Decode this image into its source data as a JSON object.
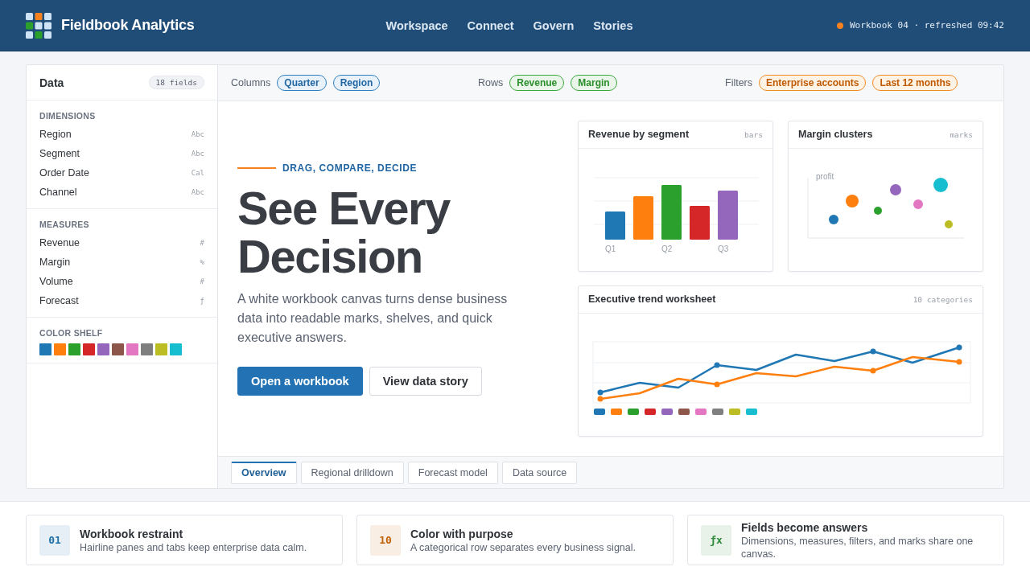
{
  "header": {
    "brand": "Fieldbook Analytics",
    "nav": [
      {
        "label": "Workspace"
      },
      {
        "label": "Connect"
      },
      {
        "label": "Govern"
      },
      {
        "label": "Stories"
      }
    ],
    "status": "Workbook 04 · refreshed 09:42"
  },
  "sidebar": {
    "title": "Data",
    "count": "18 fields",
    "sections": [
      {
        "heading": "DIMENSIONS",
        "fields": [
          {
            "name": "Region",
            "type": "Abc"
          },
          {
            "name": "Segment",
            "type": "Abc"
          },
          {
            "name": "Order Date",
            "type": "Cal"
          },
          {
            "name": "Channel",
            "type": "Abc"
          }
        ]
      },
      {
        "heading": "MEASURES",
        "fields": [
          {
            "name": "Revenue",
            "type": "#"
          },
          {
            "name": "Margin",
            "type": "%"
          },
          {
            "name": "Volume",
            "type": "#"
          },
          {
            "name": "Forecast",
            "type": "ƒ"
          }
        ]
      }
    ],
    "color_shelf": {
      "heading": "COLOR SHELF",
      "swatches": [
        {
          "color": "#1f77b4"
        },
        {
          "color": "#ff7f0e"
        },
        {
          "color": "#2ca02c"
        },
        {
          "color": "#d62728"
        },
        {
          "color": "#9467bd"
        },
        {
          "color": "#8c564b"
        },
        {
          "color": "#e377c2"
        },
        {
          "color": "#7f7f7f"
        },
        {
          "color": "#bcbd22"
        },
        {
          "color": "#17becf"
        }
      ]
    }
  },
  "shelves": [
    {
      "label": "Columns",
      "kind": "columns",
      "pills": [
        "Quarter",
        "Region"
      ]
    },
    {
      "label": "Rows",
      "kind": "rows",
      "pills": [
        "Revenue",
        "Margin"
      ]
    },
    {
      "label": "Filters",
      "kind": "filters",
      "pills": [
        "Enterprise accounts",
        "Last 12 months"
      ]
    }
  ],
  "hero": {
    "eyebrow": "DRAG, COMPARE, DECIDE",
    "title": "See Every Decision",
    "text": "A white workbook canvas turns dense business data into readable marks, shelves, and quick executive answers.",
    "buttons": [
      {
        "label": "Open a workbook",
        "kind": "primary"
      },
      {
        "label": "View data story",
        "kind": "secondary"
      }
    ]
  },
  "charts": [
    {
      "kind": "bars",
      "title": "Revenue by segment",
      "tag": "bars",
      "axis_labels": [
        "Q1",
        "Q2",
        "Q3"
      ]
    },
    {
      "kind": "scatter",
      "title": "Margin clusters",
      "tag": "marks",
      "axis_label": "profit"
    },
    {
      "kind": "trend",
      "title": "Executive trend worksheet",
      "tag": "10 categories",
      "legend": [
        {
          "color": "#1f77b4"
        },
        {
          "color": "#ff7f0e"
        },
        {
          "color": "#2ca02c"
        },
        {
          "color": "#d62728"
        },
        {
          "color": "#9467bd"
        },
        {
          "color": "#8c564b"
        },
        {
          "color": "#e377c2"
        },
        {
          "color": "#7f7f7f"
        },
        {
          "color": "#bcbd22"
        },
        {
          "color": "#17becf"
        }
      ]
    }
  ],
  "tabs": [
    {
      "label": "Overview",
      "selected": true
    },
    {
      "label": "Regional drilldown",
      "selected": false
    },
    {
      "label": "Forecast model",
      "selected": false
    },
    {
      "label": "Data source",
      "selected": false
    }
  ],
  "features": [
    {
      "badge": "01",
      "color": "#1f6fa8",
      "title": "Workbook restraint",
      "text": "Hairline panes and tabs keep enterprise data calm."
    },
    {
      "badge": "10",
      "color": "#c0620a",
      "title": "Color with purpose",
      "text": "A categorical row separates every business signal."
    },
    {
      "badge": "ƒx",
      "color": "#2e8b3a",
      "title": "Fields become answers",
      "text": "Dimensions, measures, filters, and marks share one canvas."
    }
  ]
}
